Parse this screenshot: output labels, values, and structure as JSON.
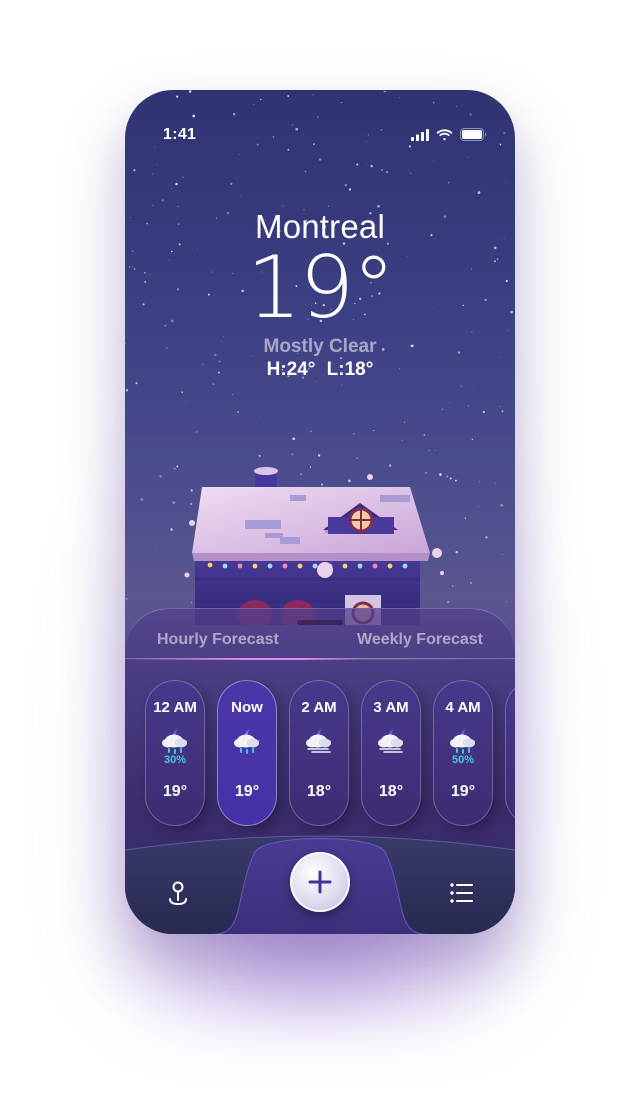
{
  "status_bar": {
    "time": "1:41"
  },
  "location": {
    "city": "Montreal",
    "temperature": "19°",
    "condition": "Mostly Clear",
    "high_low": "H:24° L:18°"
  },
  "forecast_tabs": [
    {
      "label": "Hourly Forecast"
    },
    {
      "label": "Weekly Forecast"
    }
  ],
  "hourly": [
    {
      "time": "12 AM",
      "precip": "30%",
      "temp": "19°",
      "icon": "rain-moon-cloud-icon"
    },
    {
      "time": "Now",
      "precip": "",
      "temp": "19°",
      "icon": "rain-moon-cloud-icon"
    },
    {
      "time": "2 AM",
      "precip": "",
      "temp": "18°",
      "icon": "wind-moon-cloud-icon"
    },
    {
      "time": "3 AM",
      "precip": "",
      "temp": "18°",
      "icon": "wind-moon-cloud-icon"
    },
    {
      "time": "4 AM",
      "precip": "50%",
      "temp": "19°",
      "icon": "rain-moon-cloud-icon"
    }
  ],
  "tab_bar": {
    "left_icon": "map-pin-icon",
    "center_icon": "plus-icon",
    "right_icon": "list-icon"
  },
  "colors": {
    "accent": "#48319d",
    "precip": "#40cbd8",
    "sky_top": "#2f3371",
    "sheet": "#3c2c6c"
  }
}
